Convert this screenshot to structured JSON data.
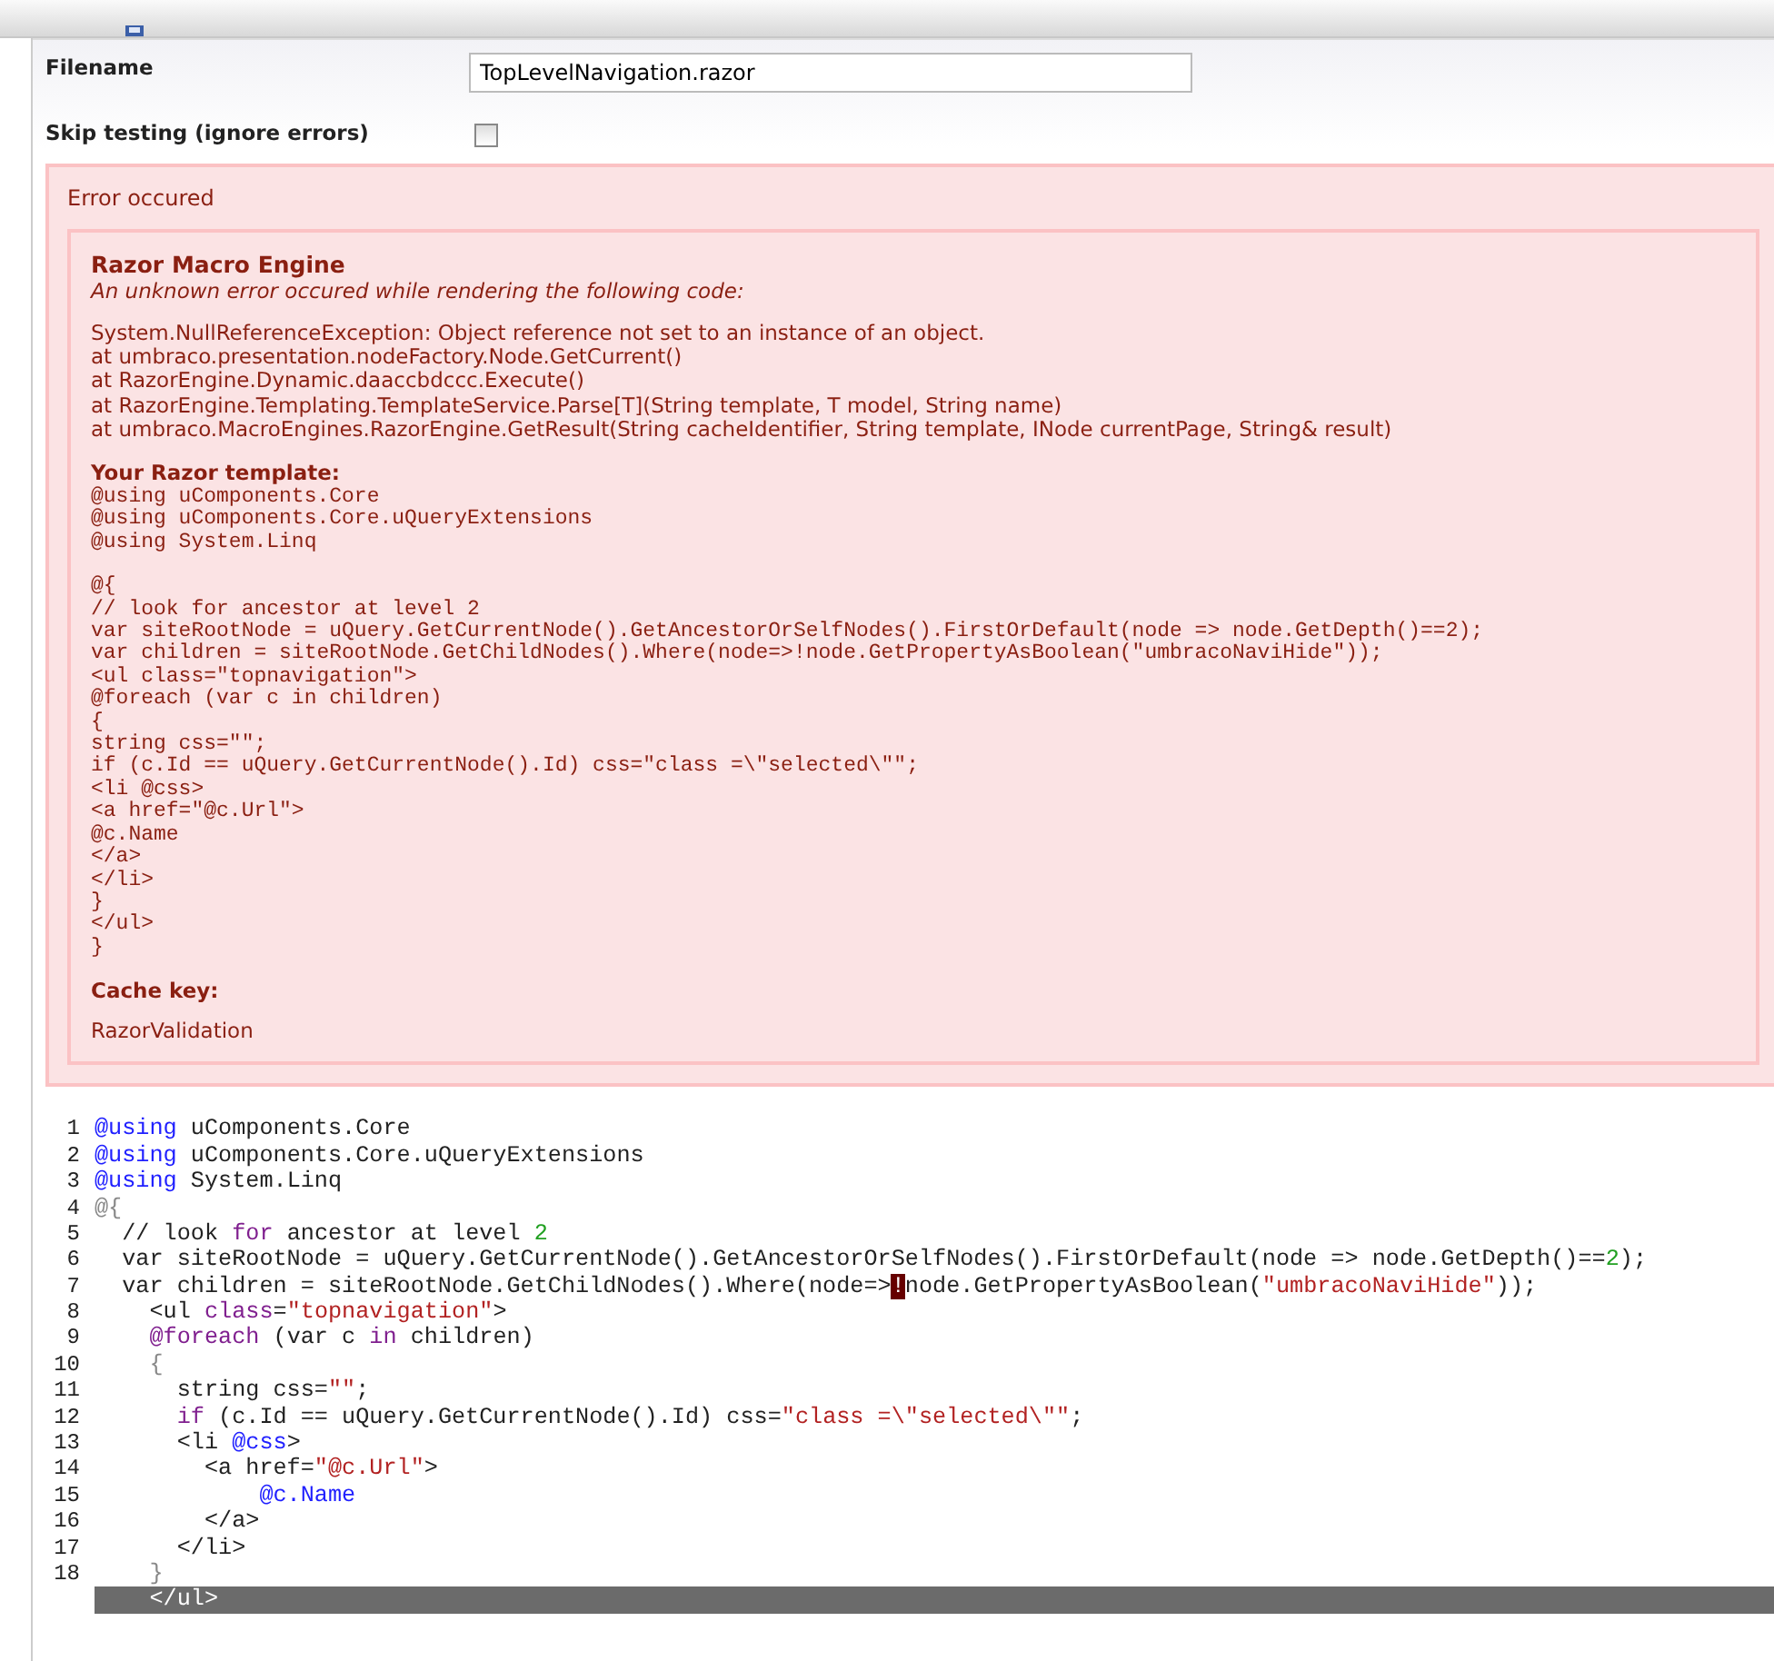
{
  "fields": [
    {
      "kind": "text",
      "label": "Filename",
      "value": "TopLevelNavigation.razor"
    },
    {
      "kind": "checkbox",
      "label": "Skip testing (ignore errors)",
      "checked": false
    }
  ],
  "error": {
    "title": "Error occured",
    "engine": "Razor Macro Engine",
    "intro": "An unknown error occured while rendering the following code:",
    "trace": [
      "System.NullReferenceException: Object reference not set to an instance of an object.",
      "at umbraco.presentation.nodeFactory.Node.GetCurrent()",
      "at RazorEngine.Dynamic.daaccbdccc.Execute()",
      "at RazorEngine.Templating.TemplateService.Parse[T](String template, T model, String name)",
      "at umbraco.MacroEngines.RazorEngine.GetResult(String cacheIdentifier, String template, INode currentPage, String& result)"
    ],
    "template_heading": "Your Razor template:",
    "template_blocks": [
      [
        "@using uComponents.Core",
        "@using uComponents.Core.uQueryExtensions",
        "@using System.Linq"
      ],
      [
        "@{",
        "// look for ancestor at level 2",
        "var siteRootNode = uQuery.GetCurrentNode().GetAncestorOrSelfNodes().FirstOrDefault(node => node.GetDepth()==2);",
        "var children = siteRootNode.GetChildNodes().Where(node=>!node.GetPropertyAsBoolean(\"umbracoNaviHide\"));",
        "<ul class=\"topnavigation\">",
        "@foreach (var c in children)",
        "{",
        "string css=\"\";",
        "if (c.Id == uQuery.GetCurrentNode().Id) css=\"class =\\\"selected\\\"\";",
        "<li @css>",
        "<a href=\"@c.Url\">",
        "@c.Name",
        "</a>",
        "</li>",
        "}",
        "</ul>",
        "}"
      ]
    ],
    "cache_heading": "Cache key:",
    "cache_key": "RazorValidation"
  },
  "editor": {
    "lines": [
      {
        "number": "1",
        "selected": false,
        "tokens": [
          {
            "kind": "directive",
            "text": "@using"
          },
          {
            "kind": "plain",
            "text": " uComponents.Core"
          }
        ]
      },
      {
        "number": "2",
        "selected": false,
        "tokens": [
          {
            "kind": "directive",
            "text": "@using"
          },
          {
            "kind": "plain",
            "text": " uComponents.Core.uQueryExtensions"
          }
        ]
      },
      {
        "number": "3",
        "selected": false,
        "tokens": [
          {
            "kind": "directive",
            "text": "@using"
          },
          {
            "kind": "plain",
            "text": " System.Linq"
          }
        ]
      },
      {
        "number": "4",
        "selected": false,
        "tokens": [
          {
            "kind": "muted",
            "text": "@{"
          }
        ]
      },
      {
        "number": "5",
        "selected": false,
        "tokens": [
          {
            "kind": "plain",
            "text": "  // look "
          },
          {
            "kind": "keyword",
            "text": "for"
          },
          {
            "kind": "plain",
            "text": " ancestor at level "
          },
          {
            "kind": "number",
            "text": "2"
          }
        ]
      },
      {
        "number": "6",
        "selected": false,
        "tokens": [
          {
            "kind": "plain",
            "text": "  var siteRootNode = uQuery.GetCurrentNode().GetAncestorOrSelfNodes().FirstOrDefault(node => node.GetDepth()=="
          },
          {
            "kind": "number",
            "text": "2"
          },
          {
            "kind": "plain",
            "text": ");"
          }
        ]
      },
      {
        "number": "7",
        "selected": false,
        "tokens": [
          {
            "kind": "plain",
            "text": "  var children = siteRootNode.GetChildNodes().Where(node=>"
          },
          {
            "kind": "match",
            "text": "!"
          },
          {
            "kind": "plain",
            "text": "node.GetPropertyAsBoolean("
          },
          {
            "kind": "string",
            "text": "\"umbracoNaviHide\""
          },
          {
            "kind": "plain",
            "text": "));"
          }
        ]
      },
      {
        "number": "8",
        "selected": false,
        "tokens": [
          {
            "kind": "plain",
            "text": "    <ul "
          },
          {
            "kind": "keyword",
            "text": "class"
          },
          {
            "kind": "plain",
            "text": "="
          },
          {
            "kind": "string",
            "text": "\"topnavigation\""
          },
          {
            "kind": "plain",
            "text": ">"
          }
        ]
      },
      {
        "number": "9",
        "selected": false,
        "tokens": [
          {
            "kind": "keyword",
            "text": "    @foreach"
          },
          {
            "kind": "plain",
            "text": " (var c "
          },
          {
            "kind": "keyword",
            "text": "in"
          },
          {
            "kind": "plain",
            "text": " children)"
          }
        ]
      },
      {
        "number": "10",
        "selected": false,
        "tokens": [
          {
            "kind": "muted",
            "text": "    {"
          }
        ]
      },
      {
        "number": "11",
        "selected": false,
        "tokens": [
          {
            "kind": "plain",
            "text": "      string css="
          },
          {
            "kind": "string",
            "text": "\"\""
          },
          {
            "kind": "plain",
            "text": ";"
          }
        ]
      },
      {
        "number": "12",
        "selected": false,
        "tokens": [
          {
            "kind": "keyword",
            "text": "      if"
          },
          {
            "kind": "plain",
            "text": " (c.Id == uQuery.GetCurrentNode().Id) css="
          },
          {
            "kind": "string",
            "text": "\"class =\\\"selected\\\"\""
          },
          {
            "kind": "plain",
            "text": ";"
          }
        ]
      },
      {
        "number": "13",
        "selected": false,
        "tokens": [
          {
            "kind": "plain",
            "text": "      <li "
          },
          {
            "kind": "directive",
            "text": "@css"
          },
          {
            "kind": "plain",
            "text": ">"
          }
        ]
      },
      {
        "number": "14",
        "selected": false,
        "tokens": [
          {
            "kind": "plain",
            "text": "        <a href="
          },
          {
            "kind": "string",
            "text": "\"@c.Url\""
          },
          {
            "kind": "plain",
            "text": ">"
          }
        ]
      },
      {
        "number": "15",
        "selected": false,
        "tokens": [
          {
            "kind": "directive",
            "text": "            @c.Name"
          }
        ]
      },
      {
        "number": "16",
        "selected": false,
        "tokens": [
          {
            "kind": "plain",
            "text": "        </a>"
          }
        ]
      },
      {
        "number": "17",
        "selected": false,
        "tokens": [
          {
            "kind": "plain",
            "text": "      </li>"
          }
        ]
      },
      {
        "number": "18",
        "selected": false,
        "tokens": [
          {
            "kind": "muted",
            "text": "    }"
          }
        ]
      },
      {
        "selected": true,
        "tokens": [
          {
            "kind": "plain",
            "text": "    </ul>"
          }
        ]
      }
    ]
  }
}
